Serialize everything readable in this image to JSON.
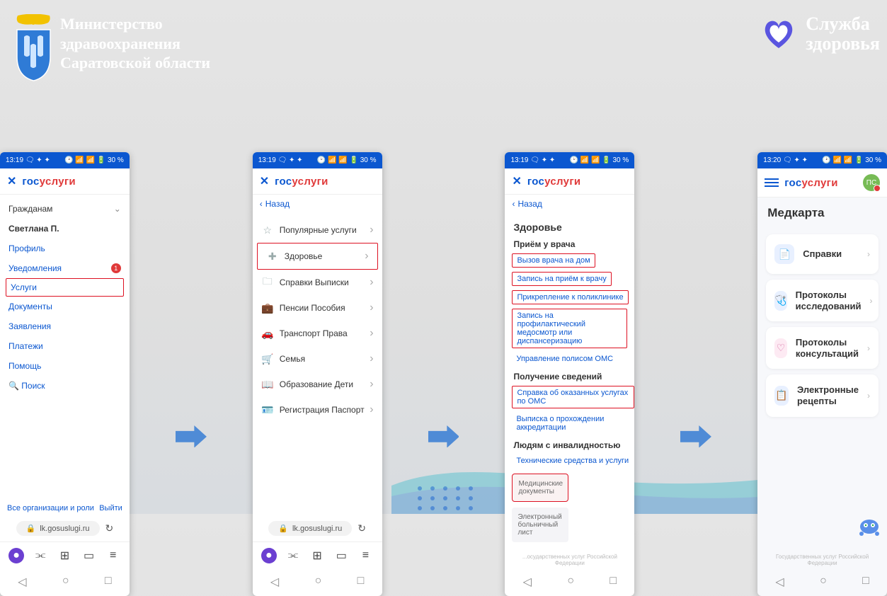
{
  "header": {
    "ministry_l1": "Министерство",
    "ministry_l2": "здравоохранения",
    "ministry_l3": "Саратовской области",
    "sluzhba_l1": "Служба",
    "sluzhba_l2": "здоровья"
  },
  "status": {
    "time1": "13:19",
    "time4": "13:20",
    "icons": "🕑 📶 📶 🔋 30 %",
    "left_icons": "🗨 ✦ ✦"
  },
  "brand": {
    "p1": "гос",
    "p2": "услуги"
  },
  "back": "Назад",
  "screen1": {
    "dropdown": "Гражданам",
    "user": "Светлана П.",
    "items": [
      {
        "label": "Профиль"
      },
      {
        "label": "Уведомления",
        "badge": "1"
      },
      {
        "label": "Услуги",
        "highlight": true
      },
      {
        "label": "Документы"
      },
      {
        "label": "Заявления"
      },
      {
        "label": "Платежи"
      },
      {
        "label": "Помощь"
      },
      {
        "label": "Поиск",
        "search": true
      }
    ],
    "all_orgs": "Все организации и роли",
    "logout": "Выйти",
    "url": "lk.gosuslugi.ru"
  },
  "screen2": {
    "items": [
      {
        "icon": "star",
        "label": "Популярные услуги"
      },
      {
        "icon": "plus",
        "label": "Здоровье",
        "highlight": true
      },
      {
        "icon": "folder",
        "label": "Справки Выписки"
      },
      {
        "icon": "wallet",
        "label": "Пенсии Пособия"
      },
      {
        "icon": "car",
        "label": "Транспорт Права"
      },
      {
        "icon": "cart",
        "label": "Семья"
      },
      {
        "icon": "book",
        "label": "Образование Дети"
      },
      {
        "icon": "id",
        "label": "Регистрация Паспорт"
      }
    ],
    "url": "lk.gosuslugi.ru"
  },
  "screen3": {
    "title": "Здоровье",
    "s1": {
      "title": "Приём у врача",
      "chips": [
        {
          "label": "Вызов врача на дом",
          "hl": true
        },
        {
          "label": "Запись на приём к врачу",
          "hl": true
        },
        {
          "label": "Прикрепление к поликлинике",
          "hl": true
        },
        {
          "label": "Запись на профилактический медосмотр или диспансеризацию",
          "hl": true,
          "wide": true
        },
        {
          "label": "Управление полисом ОМС",
          "plain": true
        }
      ]
    },
    "s2": {
      "title": "Получение сведений",
      "chips": [
        {
          "label": "Справка об оказанных услугах по ОМС",
          "hl": true
        },
        {
          "label": "Выписка о прохождении аккредитации",
          "plain": true
        }
      ]
    },
    "s3": {
      "title": "Людям с инвалидностью",
      "chips": [
        {
          "label": "Технические средства и услуги",
          "plain": true
        }
      ]
    },
    "cards": [
      {
        "label": "Медицинские документы",
        "hl": true
      },
      {
        "label": "Электронный больничный лист"
      }
    ],
    "footer": "...осударственных услуг Российской Федерации"
  },
  "screen4": {
    "title": "Медкарта",
    "cards": [
      {
        "icon": "doc",
        "color": "#e8f0ff",
        "fg": "#3a74e0",
        "label": "Справки"
      },
      {
        "icon": "steth",
        "color": "#e8f0ff",
        "fg": "#3a74e0",
        "label": "Протоколы исследований"
      },
      {
        "icon": "heart",
        "color": "#fdeaf3",
        "fg": "#d46aa0",
        "label": "Протоколы консультаций"
      },
      {
        "icon": "rx",
        "color": "#e8f0ff",
        "fg": "#3a74e0",
        "label": "Электронные рецепты"
      }
    ],
    "footer": "Государственных услуг Российской Федерации",
    "avatar": "ПС"
  }
}
